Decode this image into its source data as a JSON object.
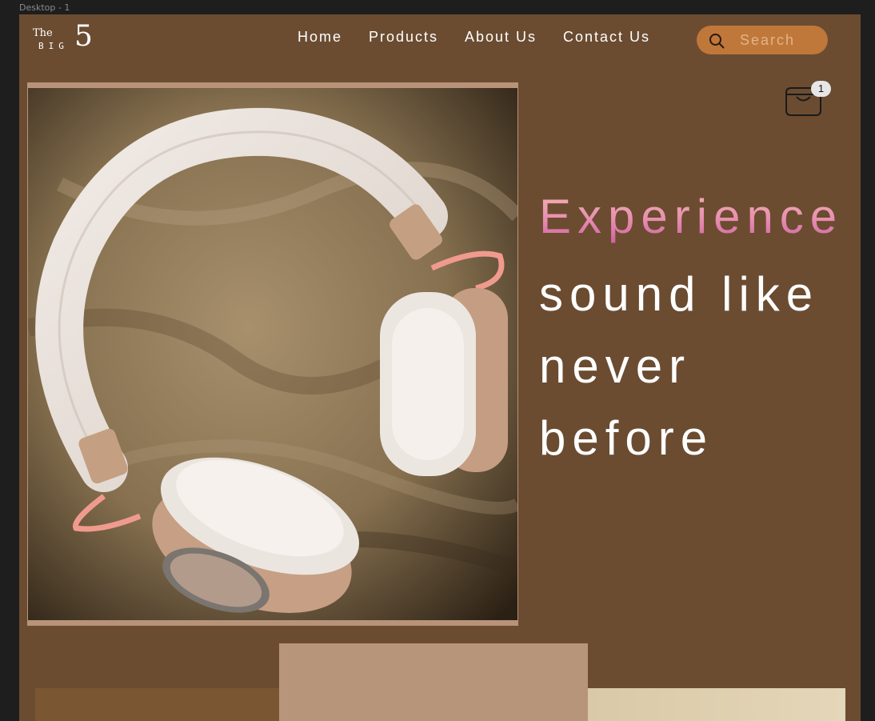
{
  "canvas": {
    "frame_label": "Desktop - 1"
  },
  "brand": {
    "the": "The",
    "big": "BIG",
    "five": "5"
  },
  "nav": {
    "items": [
      {
        "label": "Home"
      },
      {
        "label": "Products"
      },
      {
        "label": "About Us"
      },
      {
        "label": "Contact Us"
      }
    ]
  },
  "search": {
    "placeholder": "Search",
    "icon": "search-icon"
  },
  "cart": {
    "icon": "cart-icon",
    "count": "1"
  },
  "hero": {
    "image": "headphones-on-satin-photo",
    "headline": {
      "highlight": "Experience",
      "lines": [
        "sound like",
        "never",
        "before"
      ]
    }
  },
  "colors": {
    "background": "#6b4c31",
    "search_bg": "#c0773a",
    "accent_gradient": [
      "#f3b9b2",
      "#c0469a"
    ],
    "tan": "#b7957a"
  }
}
